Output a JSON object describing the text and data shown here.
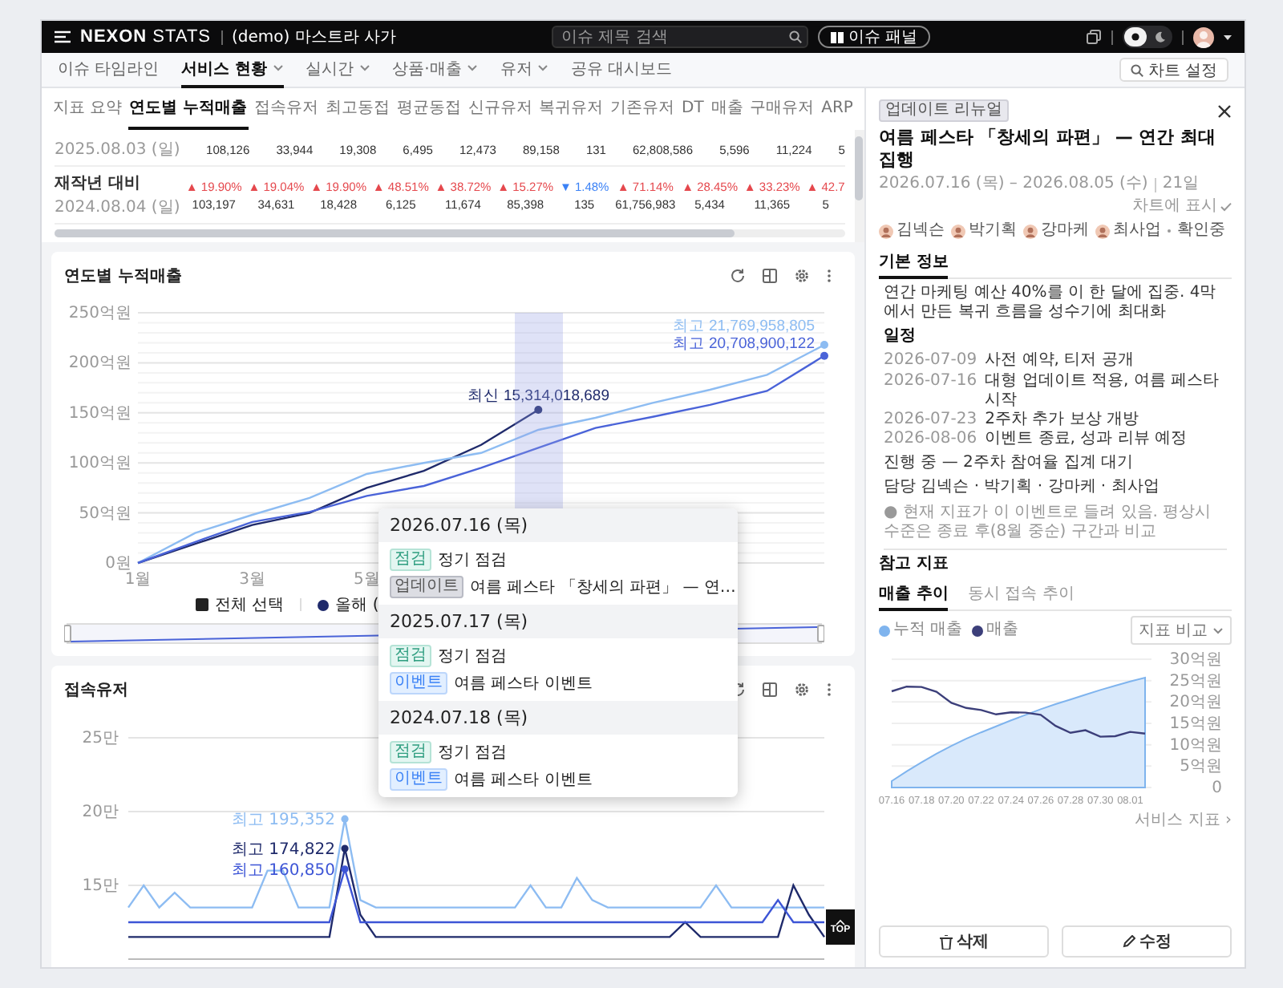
{
  "header": {
    "brand": "**NEXON** STATS",
    "project": "(demo) 마스트라 사가",
    "search": {
      "placeholder": "이슈 제목 검색"
    },
    "issue_panel_button": "이슈 패널",
    "theme_options": [
      {
        "kind": "light",
        "selected": true
      },
      {
        "kind": "dark",
        "selected": false
      }
    ]
  },
  "nav": {
    "items": [
      {
        "label": "이슈 타임라인",
        "selected": false,
        "dropdown": false
      },
      {
        "label": "서비스 현황",
        "selected": true,
        "dropdown": true
      },
      {
        "label": "실시간",
        "selected": false,
        "dropdown": true
      },
      {
        "label": "상품·매출",
        "selected": false,
        "dropdown": true
      },
      {
        "label": "유저",
        "selected": false,
        "dropdown": true
      },
      {
        "label": "공유 대시보드",
        "selected": false,
        "dropdown": false
      }
    ],
    "chart_settings_button": "차트 설정"
  },
  "metric_tabs": [
    {
      "label": "지표 요약",
      "selected": false
    },
    {
      "label": "연도별 누적매출",
      "selected": true
    },
    {
      "label": "접속유저",
      "selected": false
    },
    {
      "label": "최고동접",
      "selected": false
    },
    {
      "label": "평균동접",
      "selected": false
    },
    {
      "label": "신규유저",
      "selected": false
    },
    {
      "label": "복귀유저",
      "selected": false
    },
    {
      "label": "기존유저",
      "selected": false
    },
    {
      "label": "DT",
      "selected": false
    },
    {
      "label": "매출",
      "selected": false
    },
    {
      "label": "구매유저",
      "selected": false
    },
    {
      "label": "ARP",
      "selected": false
    }
  ],
  "table": {
    "rows": [
      {
        "date": "2025.08.03 (일)",
        "values": [
          "108,126",
          "33,944",
          "19,308",
          "6,495",
          "12,473",
          "89,158",
          "131",
          "62,808,586",
          "5,596",
          "11,224",
          "5"
        ]
      },
      {
        "label": "재작년 대비",
        "date": "2024.08.04 (일)",
        "changes": [
          {
            "text": "▲ 19.90%",
            "color": "#e5484d"
          },
          {
            "text": "▲ 19.04%",
            "color": "#e5484d"
          },
          {
            "text": "▲ 19.90%",
            "color": "#e5484d"
          },
          {
            "text": "▲ 48.51%",
            "color": "#e5484d"
          },
          {
            "text": "▲ 38.72%",
            "color": "#e5484d"
          },
          {
            "text": "▲ 15.27%",
            "color": "#e5484d"
          },
          {
            "text": "▼ 1.48%",
            "color": "#3b82f6"
          },
          {
            "text": "▲ 71.14%",
            "color": "#e5484d"
          },
          {
            "text": "▲ 28.45%",
            "color": "#e5484d"
          },
          {
            "text": "▲ 33.23%",
            "color": "#e5484d"
          },
          {
            "text": "▲ 42.7",
            "color": "#e5484d"
          }
        ],
        "values": [
          "103,197",
          "34,631",
          "18,428",
          "6,125",
          "11,674",
          "85,398",
          "135",
          "61,756,983",
          "5,434",
          "11,365",
          "5"
        ]
      }
    ]
  },
  "revenue_chart": {
    "title": "연도별 누적매출",
    "chart_data": {
      "type": "line",
      "x": [
        1,
        2,
        3,
        4,
        5,
        6,
        7,
        8,
        9,
        10,
        11,
        12,
        13
      ],
      "series": [
        {
          "name": "올해 (",
          "color": "#1f2a6b",
          "values": [
            0,
            19,
            38,
            50,
            75,
            92,
            118,
            153,
            null,
            null,
            null,
            null,
            null
          ]
        },
        {
          "color": "#8dbcf2",
          "values": [
            0,
            30,
            48,
            65,
            89,
            100,
            110,
            133,
            145,
            160,
            173,
            188,
            218
          ]
        },
        {
          "color": "#4a63d8",
          "values": [
            0,
            21,
            41,
            51,
            67,
            77,
            95,
            115,
            135,
            146,
            158,
            172,
            207
          ]
        }
      ],
      "xlim": [
        1,
        13
      ],
      "ylim": [
        0,
        250
      ],
      "grid": true,
      "yticks": [
        {
          "value": 0,
          "label": "0원"
        },
        {
          "value": 50,
          "label": "50억원"
        },
        {
          "value": 100,
          "label": "100억원"
        },
        {
          "value": 150,
          "label": "150억원"
        },
        {
          "value": 200,
          "label": "200억원"
        },
        {
          "value": 250,
          "label": "250억원"
        }
      ],
      "xticks": [
        {
          "value": 1,
          "label": "1월"
        },
        {
          "value": 3,
          "label": "3월"
        },
        {
          "value": 5,
          "label": "5월"
        }
      ],
      "annotations": [
        "최신 15,314,018,689",
        "최고 21,769,958,805",
        "최고 20,708,900,122"
      ]
    },
    "legend": [
      {
        "kind": "select_all",
        "label": "전체 선택",
        "checked": true
      }
    ]
  },
  "users_chart": {
    "title": "접속유저",
    "chart_data": {
      "type": "line",
      "categories": [
        null,
        null,
        null,
        null,
        null,
        null,
        null,
        null,
        null,
        null,
        null,
        null,
        null,
        null,
        null,
        null,
        null,
        null,
        null,
        null,
        null,
        null,
        null,
        null,
        null,
        null,
        null,
        null,
        null,
        null,
        null,
        null,
        null,
        null,
        null,
        null,
        null,
        null,
        null,
        null,
        null,
        null,
        null,
        null,
        null,
        null
      ],
      "grid": true,
      "series": [
        {
          "color": "#8dbcf2",
          "values": [
            13.5,
            15,
            13.5,
            14.5,
            13.5,
            13.5,
            13.5,
            13.5,
            13.5,
            16,
            16,
            13.5,
            13.5,
            13.5,
            19.5,
            14,
            13.5,
            13.5,
            13.5,
            13.5,
            13.5,
            13.5,
            13.5,
            13.5,
            13.5,
            13.5,
            15,
            13.5,
            13.5,
            15.5,
            14,
            13.5,
            13.5,
            13.5,
            13.5,
            13.5,
            13.5,
            13.5,
            15,
            13.5,
            13.5,
            13.5,
            13.5,
            13.5,
            13.5,
            13.5
          ]
        },
        {
          "color": "#1f2a6b",
          "values": [
            11.5,
            11.5,
            11.5,
            11.5,
            11.5,
            11.5,
            11.5,
            11.5,
            11.5,
            11.5,
            11.5,
            11.5,
            11.5,
            11.5,
            17.5,
            13,
            11.5,
            11.5,
            11.5,
            11.5,
            11.5,
            11.5,
            11.5,
            11.5,
            11.5,
            11.5,
            11.5,
            11.5,
            11.5,
            11.5,
            11.5,
            11.5,
            11.5,
            11.5,
            11.5,
            11.5,
            12.5,
            11.5,
            11.5,
            11.5,
            11.5,
            11.5,
            11.5,
            15,
            13,
            11.5
          ]
        },
        {
          "color": "#3d55d6",
          "values": [
            12.5,
            12.5,
            12.5,
            12.5,
            12.5,
            12.5,
            12.5,
            12.5,
            12.5,
            12.5,
            12.5,
            12.5,
            12.5,
            12.5,
            16.1,
            12.5,
            12.5,
            12.5,
            12.5,
            12.5,
            12.5,
            12.5,
            12.5,
            12.5,
            12.5,
            12.5,
            12.5,
            12.5,
            12.5,
            12.5,
            12.5,
            12.5,
            12.5,
            12.5,
            12.5,
            12.5,
            12.5,
            12.5,
            12.5,
            12.5,
            12.5,
            12.5,
            14,
            12.5,
            12.5,
            12.5
          ]
        }
      ],
      "ylim": [
        10,
        25
      ],
      "yticks": [
        {
          "value": 25,
          "label": "25만"
        },
        {
          "value": 20,
          "label": "20만"
        },
        {
          "value": 15,
          "label": "15만"
        }
      ],
      "annotations": [
        "최고 195,352",
        "최고 174,822",
        "최고 160,850"
      ]
    }
  },
  "tooltip": {
    "days": [
      {
        "date": "2026.07.16 (목)",
        "events": [
          {
            "kind": "maintenance",
            "tag": "점검",
            "text": "정기 점검"
          },
          {
            "kind": "update",
            "tag": "업데이트",
            "text": "여름 페스타 「창세의 파편」 — 연…"
          }
        ]
      },
      {
        "date": "2025.07.17 (목)",
        "events": [
          {
            "kind": "maintenance",
            "tag": "점검",
            "text": "정기 점검"
          },
          {
            "kind": "event",
            "tag": "이벤트",
            "text": "여름 페스타 이벤트"
          }
        ]
      },
      {
        "date": "2024.07.18 (목)",
        "events": [
          {
            "kind": "maintenance",
            "tag": "점검",
            "text": "정기 점검"
          },
          {
            "kind": "event",
            "tag": "이벤트",
            "text": "여름 페스타 이벤트"
          }
        ]
      }
    ]
  },
  "top_button": "TOP",
  "detail": {
    "badge": "업데이트 리뉴얼",
    "title": "여름 페스타 「창세의 파편」 — 연간 최대 집행",
    "period": "2026.07.16 (목) – 2026.08.05 (수)",
    "duration": "21일",
    "show_on_chart": {
      "label": "차트에 표시",
      "checked": true
    },
    "people": [
      {
        "name": "김넥슨"
      },
      {
        "name": "박기획"
      },
      {
        "name": "강마케"
      },
      {
        "name": "최사업"
      }
    ],
    "status": "확인중",
    "tabs": [
      {
        "label": "기본 정보",
        "selected": true
      }
    ],
    "description": "연간 마케팅 예산 40%를 이 한 달에 집중. 4막에서 만든 복귀 흐름을 성수기에 최대화",
    "schedule_title": "일정",
    "schedule": [
      {
        "date": "2026-07-09",
        "text": "사전 예약, 티저 공개"
      },
      {
        "date": "2026-07-16",
        "text": "대형 업데이트 적용, 여름 페스타 시작"
      },
      {
        "date": "2026-07-23",
        "text": "2주차 추가 보상 개방"
      },
      {
        "date": "2026-08-06",
        "text": "이벤트 종료, 성과 리뷰 예정"
      }
    ],
    "progress": "진행 중 — 2주차 참여율 집계 대기",
    "owners": "담당 김넥슨 · 박기획 · 강마케 · 최사업",
    "note": "● 현재 지표가 이 이벤트로 들려 있음. 평상시 수준은 종료 후(8월 중순) 구간과 비교"
  },
  "reference": {
    "title": "참고 지표",
    "tabs": [
      {
        "label": "매출 추이",
        "selected": true
      },
      {
        "label": "동시 접속 추이",
        "selected": false
      }
    ],
    "compare_select": "지표 비교",
    "chart_data": {
      "type": "line",
      "categories": [
        "07.16",
        null,
        "07.18",
        null,
        "07.20",
        null,
        "07.22",
        null,
        "07.24",
        null,
        "07.26",
        null,
        "07.28",
        null,
        "07.30",
        null,
        "08.01",
        null
      ],
      "series": [
        {
          "name": "누적 매출",
          "type": "area",
          "color": "#7fb4ee",
          "values": [
            1.5,
            3.8,
            5.9,
            7.9,
            9.7,
            11.4,
            12.9,
            14.3,
            15.7,
            17,
            18.3,
            19.5,
            20.6,
            21.7,
            22.8,
            23.8,
            24.8,
            25.7
          ]
        },
        {
          "name": "매출",
          "type": "line",
          "color": "#3c3f7a",
          "values": [
            22.5,
            23.6,
            23.5,
            22.4,
            19.8,
            18.6,
            18.1,
            17.1,
            17.6,
            17.5,
            17,
            14.4,
            12.8,
            13.4,
            11.9,
            12,
            13,
            12.6
          ]
        }
      ],
      "ylim": [
        0,
        30
      ],
      "grid": true,
      "yticks": [
        {
          "value": 0,
          "label": "0"
        },
        {
          "value": 5,
          "label": "5억원"
        },
        {
          "value": 10,
          "label": "10억원"
        },
        {
          "value": 15,
          "label": "15억원"
        },
        {
          "value": 20,
          "label": "20억원"
        },
        {
          "value": 25,
          "label": "25억원"
        },
        {
          "value": 30,
          "label": "30억원"
        }
      ]
    },
    "link": "서비스 지표 ›"
  },
  "actions": {
    "delete": "삭제",
    "edit": "수정"
  }
}
